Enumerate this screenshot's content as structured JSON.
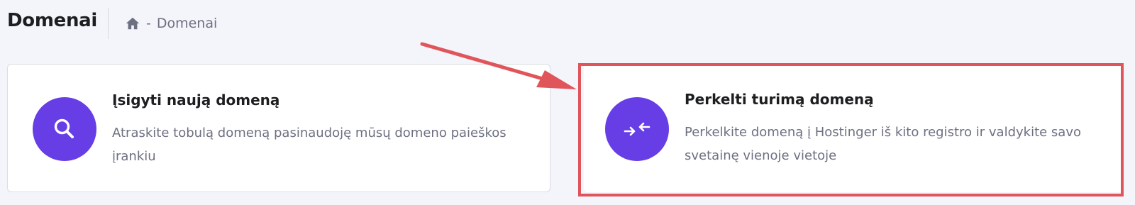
{
  "header": {
    "title": "Domenai",
    "breadcrumb": {
      "home_icon": "home-icon",
      "separator": "-",
      "current": "Domenai"
    }
  },
  "cards": {
    "buy": {
      "icon": "search-icon",
      "title": "Įsigyti naują domeną",
      "description": "Atraskite tobulą domeną pasinaudoję mūsų domeno paieškos įrankiu"
    },
    "transfer": {
      "icon": "transfer-arrows-icon",
      "title": "Perkelti turimą domeną",
      "description": "Perkelkite domeną į Hostinger iš kito registro ir valdykite savo svetainę vienoje vietoje"
    }
  },
  "annotation": {
    "highlight_color": "#e0555a"
  },
  "colors": {
    "accent": "#673de6",
    "background": "#f4f4fb",
    "card": "#ffffff",
    "muted_text": "#6d7081"
  }
}
